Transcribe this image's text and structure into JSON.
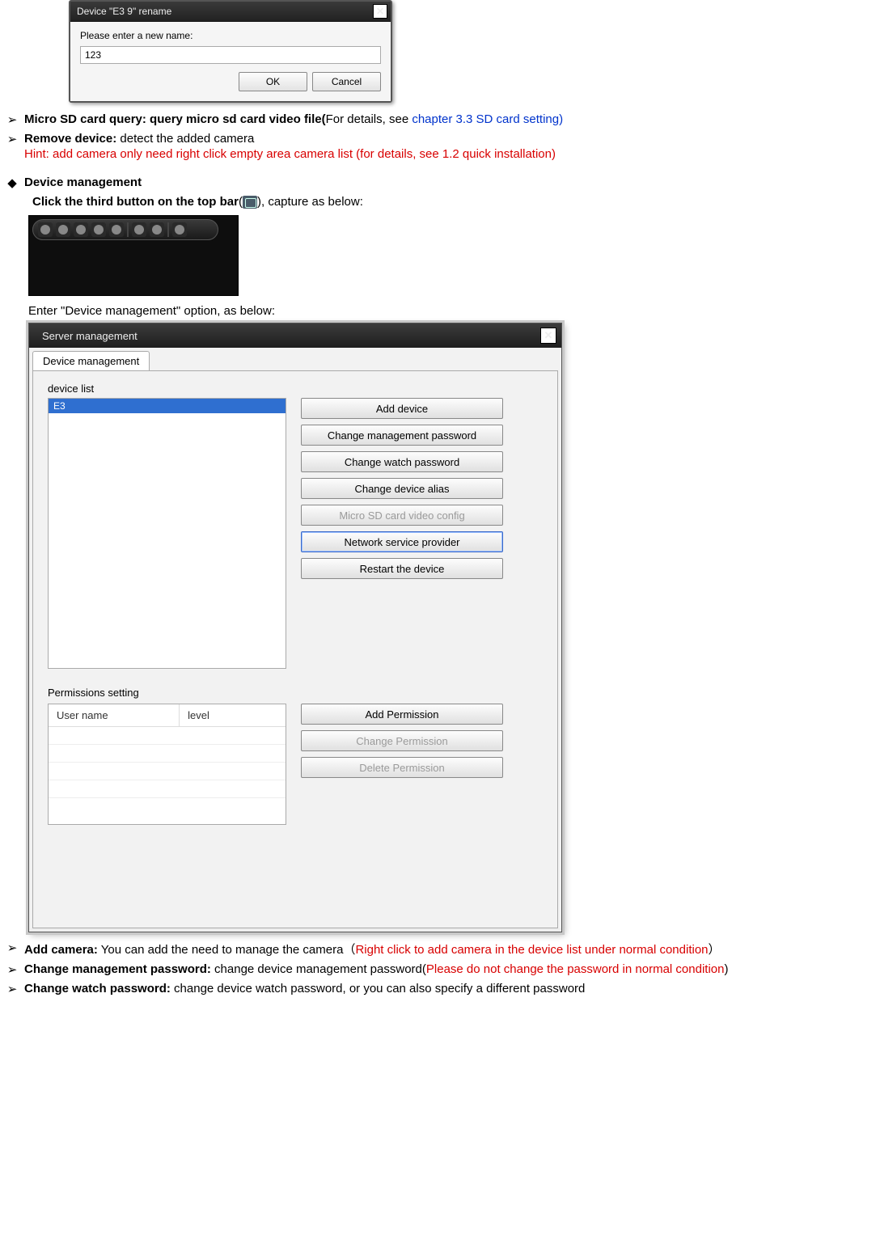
{
  "rename_dialog": {
    "title": "Device \"E3       9\" rename",
    "prompt": "Please enter a new name:",
    "value": "123",
    "ok": "OK",
    "cancel": "Cancel"
  },
  "bullets1": {
    "sd_bold": "Micro SD card query: query micro sd card video file(",
    "sd_tail_black": "For details, see ",
    "sd_link": "chapter 3.3 SD card setting)",
    "remove_bold": "Remove device:",
    "remove_rest": " detect the added camera",
    "hint_red": "Hint: add camera only need right click empty area camera list (for details, see 1.2 quick installation)"
  },
  "devmgmt": {
    "heading": "Device management",
    "click_bold": "Click the third button on the top bar",
    "click_paren_open": "(",
    "click_paren_close": "), capture as below:",
    "enter_text": "Enter \"Device management\" option, as below:"
  },
  "server_dialog": {
    "title": "Server management",
    "tab": "Device management",
    "device_list_label": "device list",
    "device_item": "E3",
    "buttons": {
      "add": "Add device",
      "chg_mgmt": "Change management password",
      "chg_watch": "Change watch password",
      "chg_alias": "Change device alias",
      "sd": "Micro SD card video config",
      "net": "Network service provider",
      "restart": "Restart the device"
    },
    "perm_label": "Permissions setting",
    "perm_cols": {
      "user": "User name",
      "level": "level"
    },
    "perm_buttons": {
      "add": "Add Permission",
      "chg": "Change Permission",
      "del": "Delete Permission"
    }
  },
  "bullets2": {
    "add_bold": "Add camera:",
    "add_black": " You can add the need to manage the camera（",
    "add_red": "Right click to add camera in the device list under normal condition",
    "add_close": "）",
    "chg_mgmt_bold": "Change management password:",
    "chg_mgmt_black": " change device management password(",
    "chg_mgmt_red": "Please do not change the password in normal condition",
    "chg_mgmt_close": ")",
    "chg_watch_bold": "Change watch password:",
    "chg_watch_black": " change device watch password, or you can also specify a different password"
  }
}
